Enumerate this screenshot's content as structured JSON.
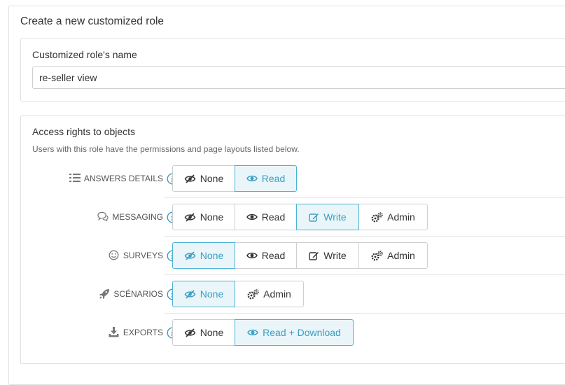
{
  "page": {
    "title": "Create a new customized role"
  },
  "name_panel": {
    "label": "Customized role's name",
    "value": "re-seller view"
  },
  "rights_panel": {
    "title": "Access rights to objects",
    "description": "Users with this role have the permissions and page layouts listed below.",
    "rows": [
      {
        "label": "ANSWERS DETAILS",
        "icon": "list-icon",
        "buttons": [
          {
            "label": "None",
            "icon": "eye-slash-icon",
            "active": false
          },
          {
            "label": "Read",
            "icon": "eye-icon",
            "active": true
          }
        ]
      },
      {
        "label": "MESSAGING",
        "icon": "comments-icon",
        "buttons": [
          {
            "label": "None",
            "icon": "eye-slash-icon",
            "active": false
          },
          {
            "label": "Read",
            "icon": "eye-icon",
            "active": false
          },
          {
            "label": "Write",
            "icon": "edit-icon",
            "active": true
          },
          {
            "label": "Admin",
            "icon": "gears-icon",
            "active": false
          }
        ]
      },
      {
        "label": "SURVEYS",
        "icon": "smile-icon",
        "buttons": [
          {
            "label": "None",
            "icon": "eye-slash-icon",
            "active": true
          },
          {
            "label": "Read",
            "icon": "eye-icon",
            "active": false
          },
          {
            "label": "Write",
            "icon": "edit-icon",
            "active": false
          },
          {
            "label": "Admin",
            "icon": "gears-icon",
            "active": false
          }
        ]
      },
      {
        "label": "SCÉNARIOS",
        "icon": "rocket-icon",
        "buttons": [
          {
            "label": "None",
            "icon": "eye-slash-icon",
            "active": true
          },
          {
            "label": "Admin",
            "icon": "gears-icon",
            "active": false
          }
        ]
      },
      {
        "label": "EXPORTS",
        "icon": "download-icon",
        "buttons": [
          {
            "label": "None",
            "icon": "eye-slash-icon",
            "active": false
          },
          {
            "label": "Read + Download",
            "icon": "eye-icon",
            "active": true
          }
        ]
      }
    ]
  },
  "colors": {
    "accent": "#3a9fc4",
    "active_bg": "#e9f5f9",
    "border": "#cfcfcf"
  }
}
